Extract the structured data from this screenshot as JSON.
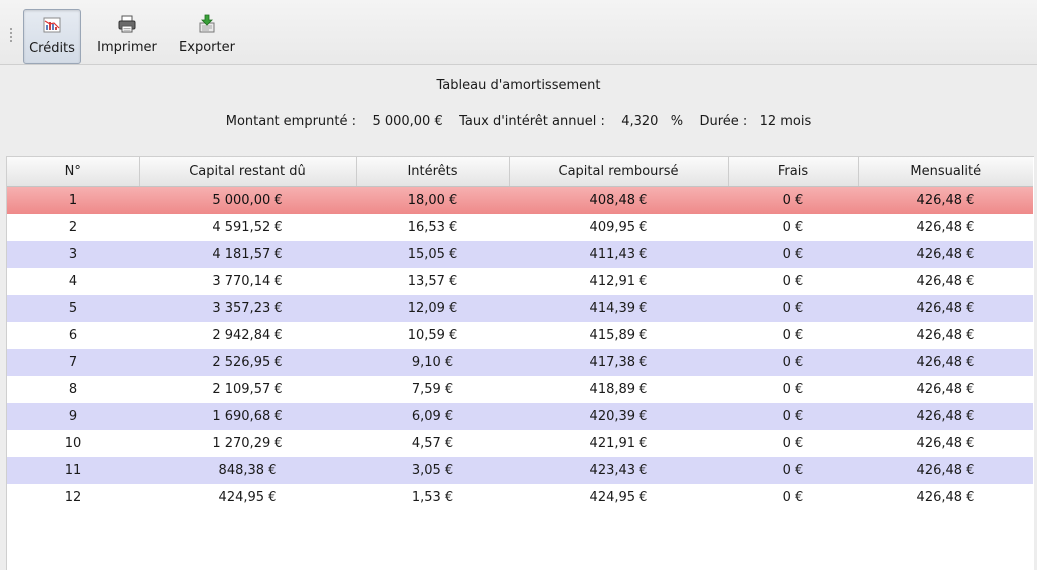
{
  "toolbar": {
    "buttons": [
      {
        "label": "Crédits",
        "icon": "chart-icon",
        "active": true
      },
      {
        "label": "Imprimer",
        "icon": "printer-icon",
        "active": false
      },
      {
        "label": "Exporter",
        "icon": "export-icon",
        "active": false
      }
    ]
  },
  "header": {
    "title": "Tableau d'amortissement",
    "amount_label": "Montant emprunté :",
    "amount_value": "5 000,00 €",
    "rate_label": "Taux d'intérêt annuel :",
    "rate_value": "4,320",
    "rate_unit": "%",
    "duration_label": "Durée :",
    "duration_value": "12 mois"
  },
  "table": {
    "columns": [
      "N°",
      "Capital restant dû",
      "Intérêts",
      "Capital remboursé",
      "Frais",
      "Mensualité"
    ],
    "rows": [
      [
        "1",
        "5 000,00 €",
        "18,00 €",
        "408,48 €",
        "0 €",
        "426,48 €"
      ],
      [
        "2",
        "4 591,52 €",
        "16,53 €",
        "409,95 €",
        "0 €",
        "426,48 €"
      ],
      [
        "3",
        "4 181,57 €",
        "15,05 €",
        "411,43 €",
        "0 €",
        "426,48 €"
      ],
      [
        "4",
        "3 770,14 €",
        "13,57 €",
        "412,91 €",
        "0 €",
        "426,48 €"
      ],
      [
        "5",
        "3 357,23 €",
        "12,09 €",
        "414,39 €",
        "0 €",
        "426,48 €"
      ],
      [
        "6",
        "2 942,84 €",
        "10,59 €",
        "415,89 €",
        "0 €",
        "426,48 €"
      ],
      [
        "7",
        "2 526,95 €",
        "9,10 €",
        "417,38 €",
        "0 €",
        "426,48 €"
      ],
      [
        "8",
        "2 109,57 €",
        "7,59 €",
        "418,89 €",
        "0 €",
        "426,48 €"
      ],
      [
        "9",
        "1 690,68 €",
        "6,09 €",
        "420,39 €",
        "0 €",
        "426,48 €"
      ],
      [
        "10",
        "1 270,29 €",
        "4,57 €",
        "421,91 €",
        "0 €",
        "426,48 €"
      ],
      [
        "11",
        "848,38 €",
        "3,05 €",
        "423,43 €",
        "0 €",
        "426,48 €"
      ],
      [
        "12",
        "424,95 €",
        "1,53 €",
        "424,95 €",
        "0 €",
        "426,48 €"
      ]
    ],
    "selected_row": 0
  },
  "colors": {
    "selected_row": "#ee8888",
    "alt_row": "#d8d8f8",
    "background": "#ededed"
  }
}
